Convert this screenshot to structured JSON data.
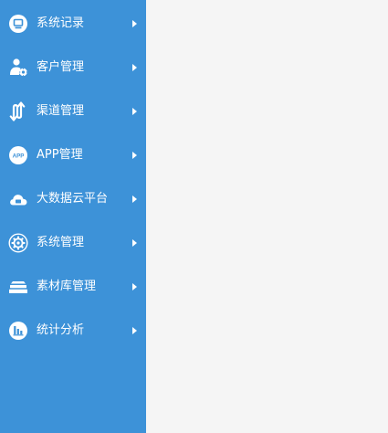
{
  "colors": {
    "sidebar_bg": "#3d92d8",
    "content_bg": "#f5f5f5",
    "text": "#ffffff"
  },
  "sidebar": {
    "items": [
      {
        "label": "系统记录",
        "icon": "monitor-icon"
      },
      {
        "label": "客户管理",
        "icon": "user-gear-icon"
      },
      {
        "label": "渠道管理",
        "icon": "channel-arrows-icon"
      },
      {
        "label": "APP管理",
        "icon": "app-icon",
        "icon_text": "APP"
      },
      {
        "label": "大数据云平台",
        "icon": "cloud-icon"
      },
      {
        "label": "系统管理",
        "icon": "gear-icon"
      },
      {
        "label": "素材库管理",
        "icon": "layers-icon"
      },
      {
        "label": "统计分析",
        "icon": "bar-chart-icon"
      }
    ]
  }
}
